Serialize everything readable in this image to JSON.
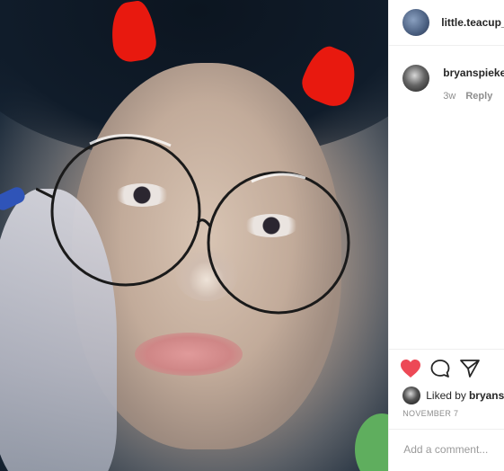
{
  "post": {
    "author": "little.teacup_",
    "date": "NOVEMBER 7"
  },
  "comment": {
    "username": "bryanspieke",
    "time": "3w",
    "reply_label": "Reply"
  },
  "likes": {
    "prefix": "Liked by",
    "user": "bryans"
  },
  "add_comment": {
    "placeholder": "Add a comment..."
  },
  "icons": {
    "like": "heart-icon",
    "comment": "comment-bubble-icon",
    "share": "paper-plane-icon"
  },
  "colors": {
    "like_red": "#ed4956",
    "horn_red": "#e8190f"
  }
}
